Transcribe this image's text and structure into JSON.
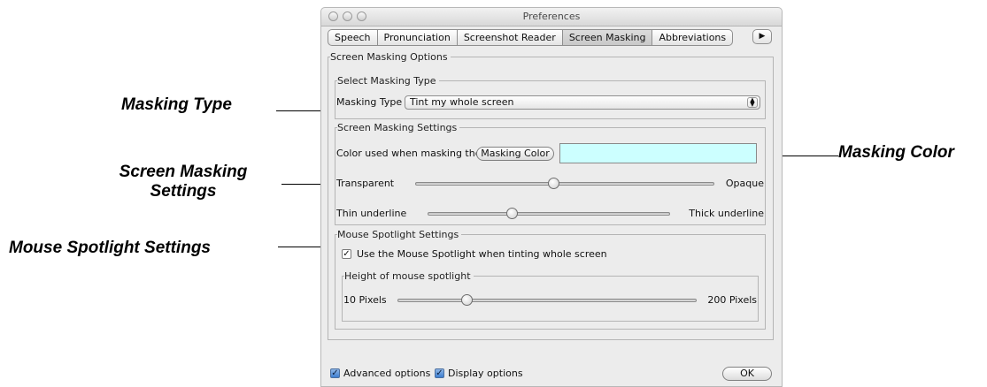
{
  "annotations": {
    "masking_type": "Masking Type",
    "masking_color": "Masking Color",
    "screen_masking_settings_line1": "Screen Masking",
    "screen_masking_settings_line2": "Settings",
    "mouse_spotlight_settings": "Mouse Spotlight Settings"
  },
  "window": {
    "title": "Preferences",
    "tabs": [
      "Speech",
      "Pronunciation",
      "Screenshot Reader",
      "Screen Masking",
      "Abbreviations"
    ],
    "selected_tab": "Screen Masking",
    "more_tabs_glyph": "▶"
  },
  "options": {
    "group_title": "Screen Masking Options",
    "select_type": {
      "group_title": "Select Masking Type",
      "label": "Masking Type",
      "value": "Tint my whole screen"
    },
    "settings": {
      "group_title": "Screen Masking Settings",
      "color_label": "Color used when masking the screen",
      "color_button": "Masking Color",
      "color_value": "#ccffff",
      "opacity": {
        "min_label": "Transparent",
        "max_label": "Opaque",
        "value": 0.46
      },
      "underline": {
        "min_label": "Thin underline",
        "max_label": "Thick underline",
        "value": 0.34
      }
    },
    "spotlight": {
      "group_title": "Mouse Spotlight Settings",
      "use_checkbox_label": "Use the Mouse Spotlight when tinting whole screen",
      "use_checked": true,
      "height": {
        "group_title": "Height of mouse spotlight",
        "min_label": "10 Pixels",
        "max_label": "200 Pixels",
        "value": 0.22
      }
    }
  },
  "footer": {
    "advanced_label": "Advanced options",
    "advanced_checked": true,
    "display_label": "Display options",
    "display_checked": true,
    "ok_label": "OK"
  }
}
